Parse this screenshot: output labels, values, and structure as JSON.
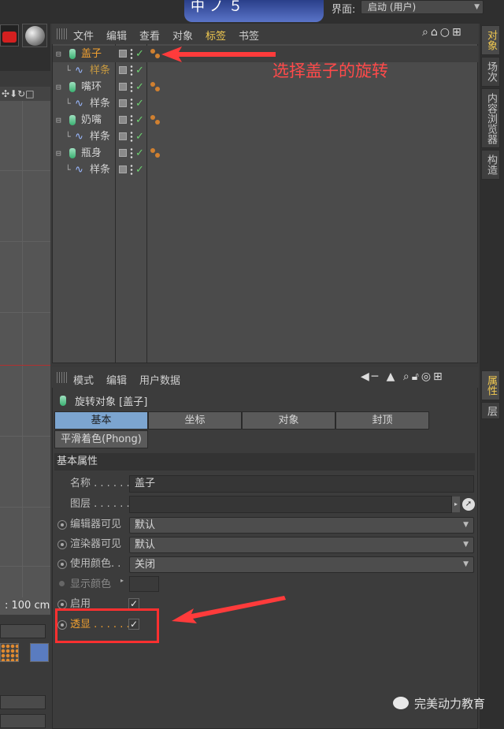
{
  "top_bar": {
    "banner_glyphs": "中ノ５",
    "layout_label": "界面:",
    "layout_value": "启动 (用户)"
  },
  "viewport": {
    "scale_readout": ": 100 cm"
  },
  "object_manager": {
    "menu": [
      "文件",
      "编辑",
      "查看",
      "对象",
      "标签",
      "书签"
    ],
    "active_menu_index": 4,
    "tree": [
      {
        "name": "盖子",
        "level": 0,
        "selected": true,
        "icon": "bottle-icon",
        "has_tag": true
      },
      {
        "name": "样条",
        "level": 1,
        "selected": false,
        "icon": "spline-icon",
        "has_tag": false,
        "highlight": true
      },
      {
        "name": "嘴环",
        "level": 0,
        "selected": false,
        "icon": "bottle-icon",
        "has_tag": true
      },
      {
        "name": "样条",
        "level": 1,
        "selected": false,
        "icon": "spline-icon",
        "has_tag": false
      },
      {
        "name": "奶嘴",
        "level": 0,
        "selected": false,
        "icon": "bottle-icon",
        "has_tag": true
      },
      {
        "name": "样条",
        "level": 1,
        "selected": false,
        "icon": "spline-icon",
        "has_tag": false
      },
      {
        "name": "瓶身",
        "level": 0,
        "selected": false,
        "icon": "bottle-icon",
        "has_tag": true
      },
      {
        "name": "样条",
        "level": 1,
        "selected": false,
        "icon": "spline-icon",
        "has_tag": false
      }
    ],
    "annotation": "选择盖子的旋转"
  },
  "side_tabs_top": [
    "对象",
    "场次",
    "内容浏览器",
    "构造"
  ],
  "side_tabs_bottom": [
    "属性",
    "层"
  ],
  "attribute_manager": {
    "menu": [
      "模式",
      "编辑",
      "用户数据"
    ],
    "object_title": "旋转对象 [盖子]",
    "tabs": [
      "基本",
      "坐标",
      "对象",
      "封顶"
    ],
    "tab_row2": "平滑着色(Phong)",
    "active_tab_index": 0,
    "section_title": "基本属性",
    "props": {
      "name_label": "名称 . . . . . .",
      "name_value": "盖子",
      "layer_label": "图层 . . . . . .",
      "editor_vis_label": "编辑器可见",
      "editor_vis_value": "默认",
      "render_vis_label": "渲染器可见",
      "render_vis_value": "默认",
      "use_color_label": "使用颜色. .",
      "use_color_value": "关闭",
      "display_color_label": "显示颜色",
      "enable_label": "启用",
      "xray_label": "透显 . . . . . ."
    }
  },
  "watermark": "完美动力教育",
  "colors": {
    "accent_orange": "#f0a030",
    "annotation_red": "#ff3030",
    "active_tab_blue": "#7ca5d0",
    "menu_active_yellow": "#f0c850"
  }
}
